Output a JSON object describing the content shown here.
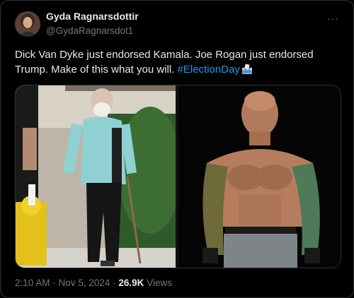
{
  "author": {
    "display_name": "Gyda Ragnarsdottir",
    "handle": "@GydaRagnarsdot1"
  },
  "tweet": {
    "text": "Dick Van Dyke just endorsed Kamala. Joe Rogan just endorsed Trump. Make of this what you will.",
    "hashtag": "#ElectionDay",
    "emoji_icon": "ballot-box-icon"
  },
  "media": {
    "images": [
      {
        "icon": "photo-older-man-walking-with-cane"
      },
      {
        "icon": "photo-shirtless-tattooed-man"
      }
    ]
  },
  "meta": {
    "time": "2:10 AM",
    "date": "Nov 5, 2024",
    "separator": "·",
    "views_count": "26.9K",
    "views_label": "Views"
  },
  "more_menu_label": "···"
}
